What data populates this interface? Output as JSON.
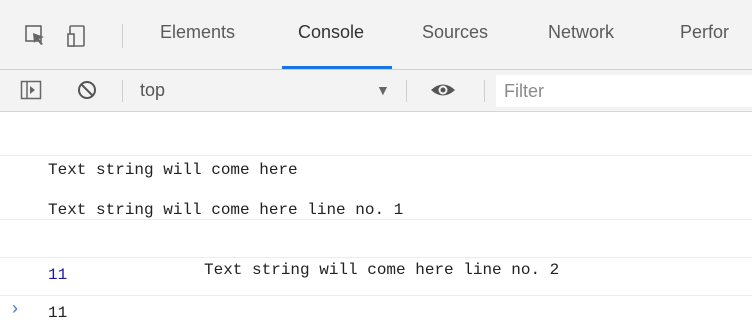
{
  "tabs": [
    {
      "label": "Elements"
    },
    {
      "label": "Console"
    },
    {
      "label": "Sources"
    },
    {
      "label": "Network"
    },
    {
      "label": "Perfor"
    }
  ],
  "active_tab": "Console",
  "toolbar": {
    "context": "top",
    "filter_placeholder": "Filter"
  },
  "console": {
    "messages": [
      {
        "lines": [
          "Text string will come here"
        ]
      },
      {
        "lines": [
          "Text string will come here line no. 1",
          "Text string will come here line no. 2"
        ]
      },
      {
        "lines": [
          "11"
        ],
        "color": "#1a1aa6"
      },
      {
        "lines": [
          "11"
        ]
      }
    ],
    "prompt": "›"
  },
  "colors": {
    "accent": "#1a73e8",
    "number_blue": "#1a1aa6",
    "prompt_blue": "#3f7bd1"
  },
  "icons": [
    "inspect-element-icon",
    "device-toggle-icon",
    "sidebar-toggle-icon",
    "clear-console-icon",
    "eye-icon",
    "dropdown-arrow-icon",
    "prompt-caret-icon"
  ]
}
